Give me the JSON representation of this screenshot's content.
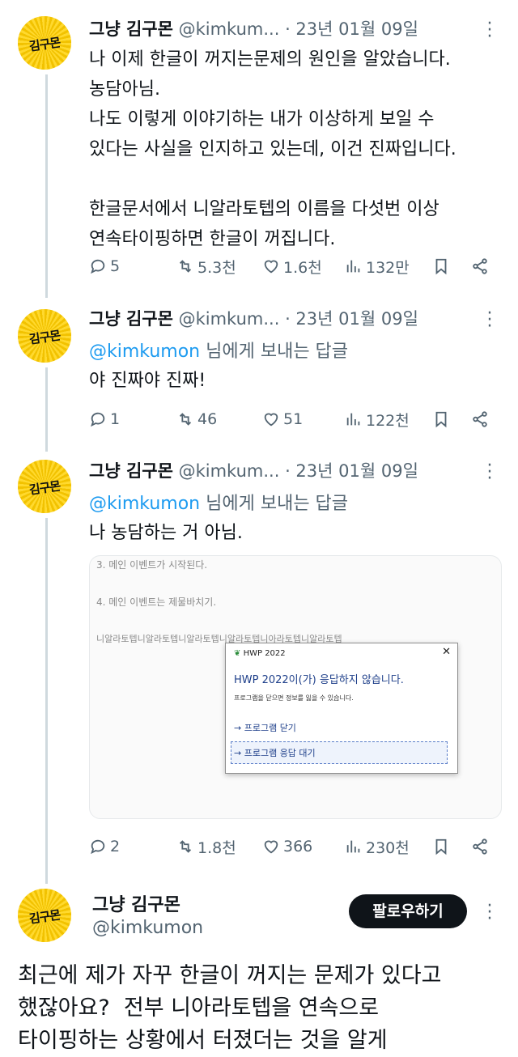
{
  "tweets": [
    {
      "author": "그냥 김구몬",
      "handle": "@kimkum...",
      "date": "· 23년 01월 09일",
      "avatar_text": "김구몬",
      "body": "나 이제 한글이 꺼지는문제의 원인을 알았습니다.\n농담아님.\n나도 이렇게 이야기하는 내가 이상하게 보일 수\n있다는 사실을 인지하고 있는데, 이건 진짜입니다.\n\n한글문서에서 니알라토텝의 이름을 다섯번 이상\n연속타이핑하면 한글이 꺼집니다.",
      "replies": "5",
      "retweets": "5.3천",
      "likes": "1.6천",
      "views": "132만"
    },
    {
      "author": "그냥 김구몬",
      "handle": "@kimkum...",
      "date": "· 23년 01월 09일",
      "avatar_text": "김구몬",
      "reply_to": "@kimkumon",
      "reply_suffix": "님에게 보내는 답글",
      "body": "야 진짜야 진짜!",
      "replies": "1",
      "retweets": "46",
      "likes": "51",
      "views": "122천"
    },
    {
      "author": "그냥 김구몬",
      "handle": "@kimkum...",
      "date": "· 23년 01월 09일",
      "avatar_text": "김구몬",
      "reply_to": "@kimkumon",
      "reply_suffix": "님에게 보내는 답글",
      "body": "나 농담하는 거 아님.",
      "replies": "2",
      "retweets": "1.8천",
      "likes": "366",
      "views": "230천"
    }
  ],
  "screenshot": {
    "line1": "3. 메인 이벤트가 시작된다.",
    "line2": "4. 메인 이벤트는 제물바치기.",
    "line3": "니알라토텝니알라토텝니알라토텝니알라토텝니아라토텝니알라토텝",
    "dialog_title": "HWP 2022",
    "dialog_close": "✕",
    "dialog_question": "HWP 2022이(가) 응답하지 않습니다.",
    "dialog_info": "프로그램을 닫으면 정보를 잃을 수 있습니다.",
    "option_close": "→ 프로그램 닫기",
    "option_wait": "→ 프로그램 응답 대기"
  },
  "main_tweet": {
    "author": "그냥 김구몬",
    "handle": "@kimkumon",
    "avatar_text": "김구몬",
    "follow_label": "팔로우하기",
    "body": "최근에 제가 자꾸 한글이 꺼지는 문제가 있다고\n했잖아요?  전부 니아라토텝을 연속으로\n타이핑하는 상황에서 터졌더는 것을 알게"
  }
}
